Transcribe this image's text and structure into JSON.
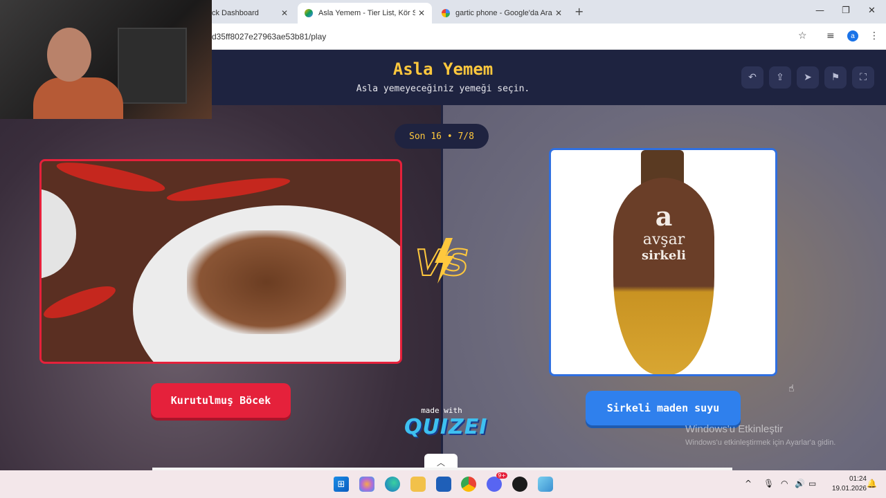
{
  "browser": {
    "tabs": [
      {
        "title": "ck Dashboard",
        "active": false
      },
      {
        "title": "Asla Yemem - Tier List, Kör Sıral",
        "active": true
      },
      {
        "title": "gartic phone - Google'da Ara",
        "active": false
      }
    ],
    "new_tab_symbol": "+",
    "close_symbol": "✕",
    "url": "d35ff8027e27963ae53b81/play",
    "profile_initial": "a",
    "window_controls": {
      "minimize": "—",
      "restore": "❐",
      "close": "✕"
    }
  },
  "quiz": {
    "title": "Asla Yemem",
    "subtitle": "Asla yemeyeceğiniz yemeği seçin.",
    "round": "Son 16 • 7/8",
    "left_choice": "Kurutulmuş Böcek",
    "right_choice": "Sirkeli maden suyu",
    "vs_label": "VS",
    "bottle_label": {
      "brand": "avşar",
      "product": "sirkeli",
      "logo": "a"
    },
    "made_with": "made with",
    "brand": "QUIZEI",
    "header_buttons": [
      "undo-icon",
      "share-icon",
      "send-icon",
      "flag-icon",
      "fullscreen-icon"
    ]
  },
  "overlay": {
    "windows_activate_title": "Windows'u Etkinleştir",
    "windows_activate_text": "Windows'u etkinleştirmek için Ayarlar'a gidin."
  },
  "taskbar": {
    "time": "01:24",
    "date": "19.01.2026",
    "discord_badge": "9+"
  },
  "colors": {
    "accent_yellow": "#ffc83d",
    "left_red": "#e5213b",
    "right_blue": "#2f80ed",
    "header_navy": "#1e2340"
  }
}
